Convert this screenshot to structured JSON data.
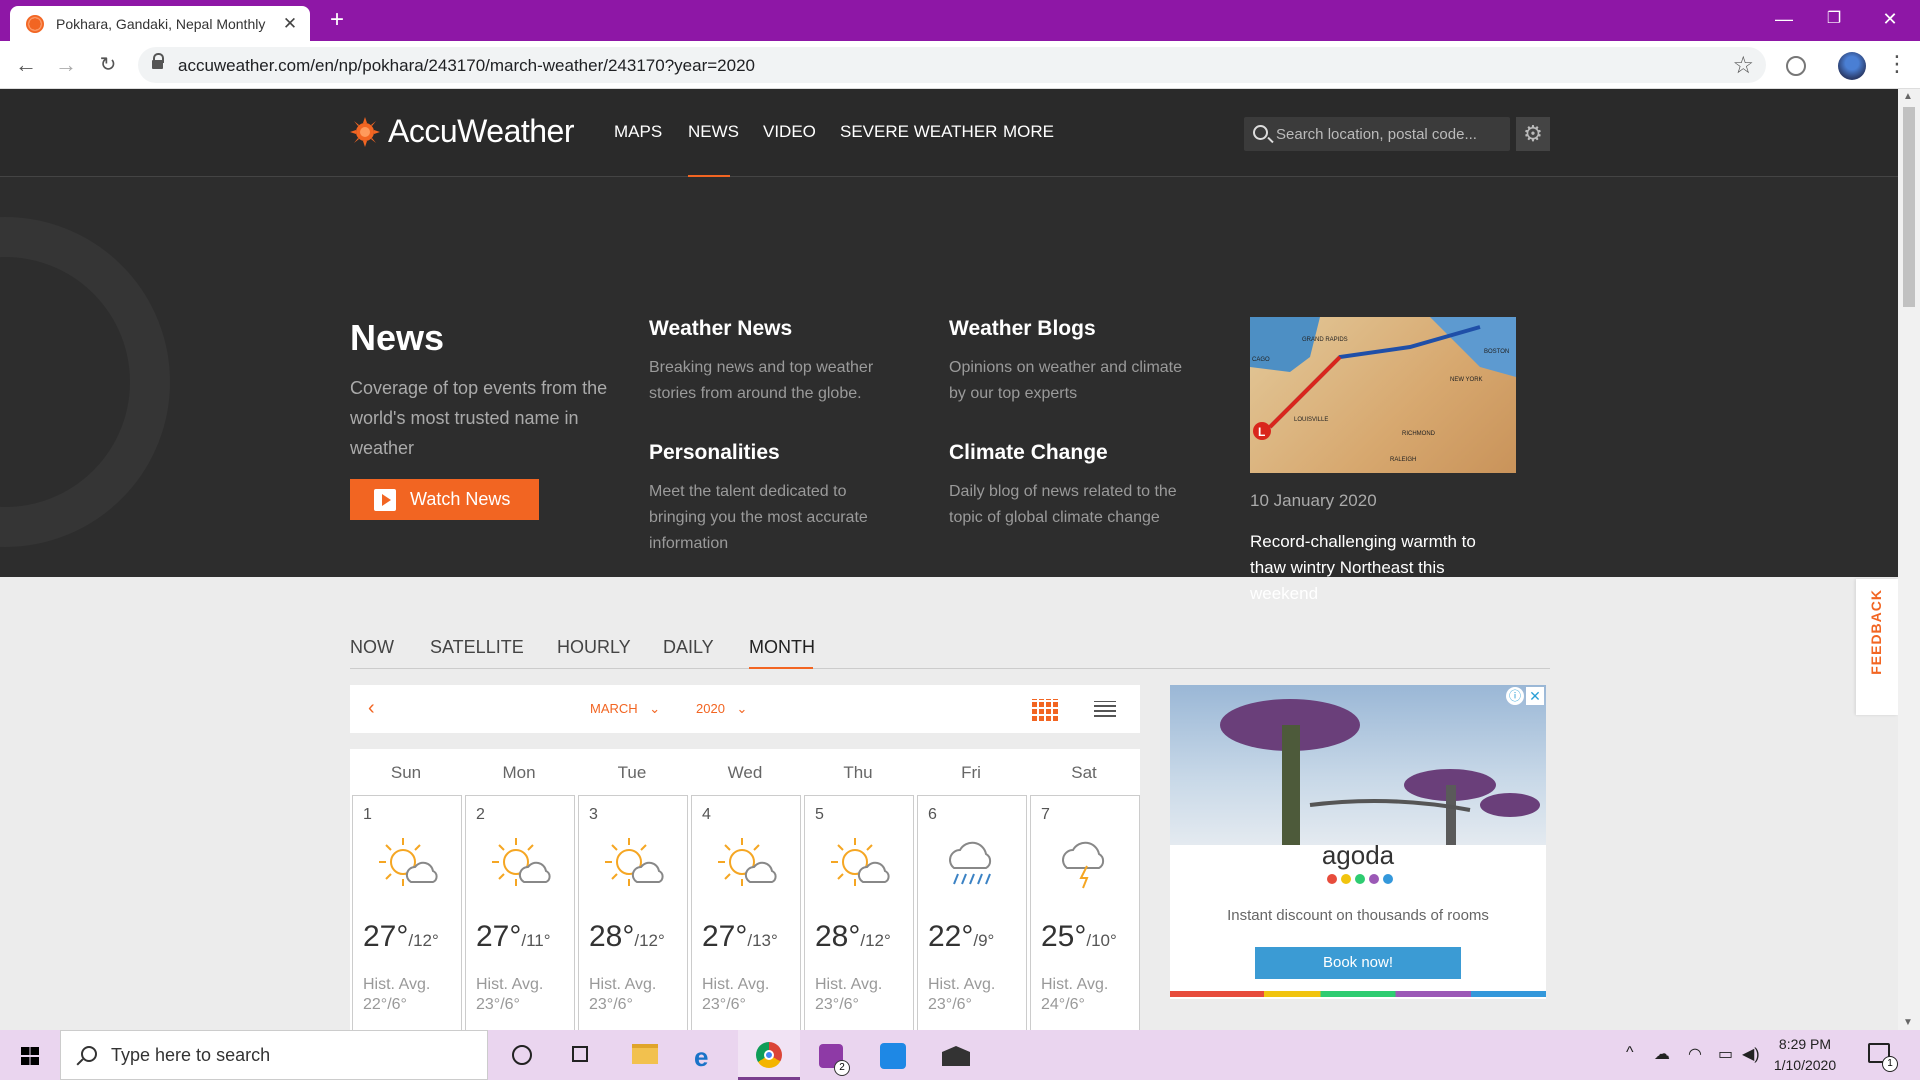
{
  "browser": {
    "tab_title": "Pokhara, Gandaki, Nepal Monthly",
    "tab_close": "✕",
    "new_tab": "+",
    "url": "accuweather.com/en/np/pokhara/243170/march-weather/243170?year=2020",
    "window_controls": {
      "minimize": "—",
      "maximize": "❐",
      "close": "✕"
    }
  },
  "site": {
    "brand": "AccuWeather",
    "brand_color": "#f26522",
    "nav": [
      "MAPS",
      "NEWS",
      "VIDEO",
      "SEVERE WEATHER",
      "MORE"
    ],
    "search_placeholder": "Search location, postal code..."
  },
  "news_menu": {
    "title": "News",
    "description": "Coverage of top events from the world's most trusted name in weather",
    "watch_button": "Watch News",
    "columns": [
      {
        "title": "Weather News",
        "desc": "Breaking news and top weather stories from around the globe."
      },
      {
        "title": "Weather Blogs",
        "desc": "Opinions on weather and climate by our top experts"
      },
      {
        "title": "Personalities",
        "desc": "Meet the talent dedicated to bringing you the most accurate information"
      },
      {
        "title": "Climate Change",
        "desc": "Daily blog of news related to the topic of global climate change"
      }
    ],
    "story": {
      "date": "10 January 2020",
      "headline": "Record-challenging warmth to thaw wintry Northeast this weekend",
      "map_cities": [
        "GRAND RAPIDS",
        "BOSTON",
        "NEW YORK",
        "CAGO",
        "LOUISVILLE",
        "RICHMOND",
        "RALEIGH"
      ],
      "low_marker": "L"
    }
  },
  "subnav": [
    "NOW",
    "SATELLITE",
    "HOURLY",
    "DAILY",
    "MONTH"
  ],
  "month_nav": {
    "month": "MARCH",
    "year": "2020",
    "prev": "‹",
    "next": "›"
  },
  "calendar": {
    "weekdays": [
      "Sun",
      "Mon",
      "Tue",
      "Wed",
      "Thu",
      "Fri",
      "Sat"
    ],
    "hist_label": "Hist. Avg.",
    "days": [
      {
        "num": "1",
        "hi": "27°",
        "lo": "/12°",
        "hist": "22°/6°",
        "icon": "partly-sunny-icon"
      },
      {
        "num": "2",
        "hi": "27°",
        "lo": "/11°",
        "hist": "23°/6°",
        "icon": "partly-sunny-icon"
      },
      {
        "num": "3",
        "hi": "28°",
        "lo": "/12°",
        "hist": "23°/6°",
        "icon": "partly-sunny-icon"
      },
      {
        "num": "4",
        "hi": "27°",
        "lo": "/13°",
        "hist": "23°/6°",
        "icon": "partly-sunny-icon"
      },
      {
        "num": "5",
        "hi": "28°",
        "lo": "/12°",
        "hist": "23°/6°",
        "icon": "partly-sunny-icon"
      },
      {
        "num": "6",
        "hi": "22°",
        "lo": "/9°",
        "hist": "23°/6°",
        "icon": "rain-icon"
      },
      {
        "num": "7",
        "hi": "25°",
        "lo": "/10°",
        "hist": "24°/6°",
        "icon": "thunderstorm-icon"
      }
    ]
  },
  "ad": {
    "brand": "agoda",
    "text": "Instant discount on thousands of rooms",
    "cta": "Book now!",
    "info": "ⓘ",
    "close": "✕",
    "dot_colors": [
      "#e74c3c",
      "#f1c40f",
      "#2ecc71",
      "#9b59b6",
      "#3498db"
    ]
  },
  "feedback": "FEEDBACK",
  "taskbar": {
    "search_placeholder": "Type here to search",
    "time": "8:29 PM",
    "date": "1/10/2020",
    "instagram_badge": "2",
    "notification_count": "1"
  }
}
